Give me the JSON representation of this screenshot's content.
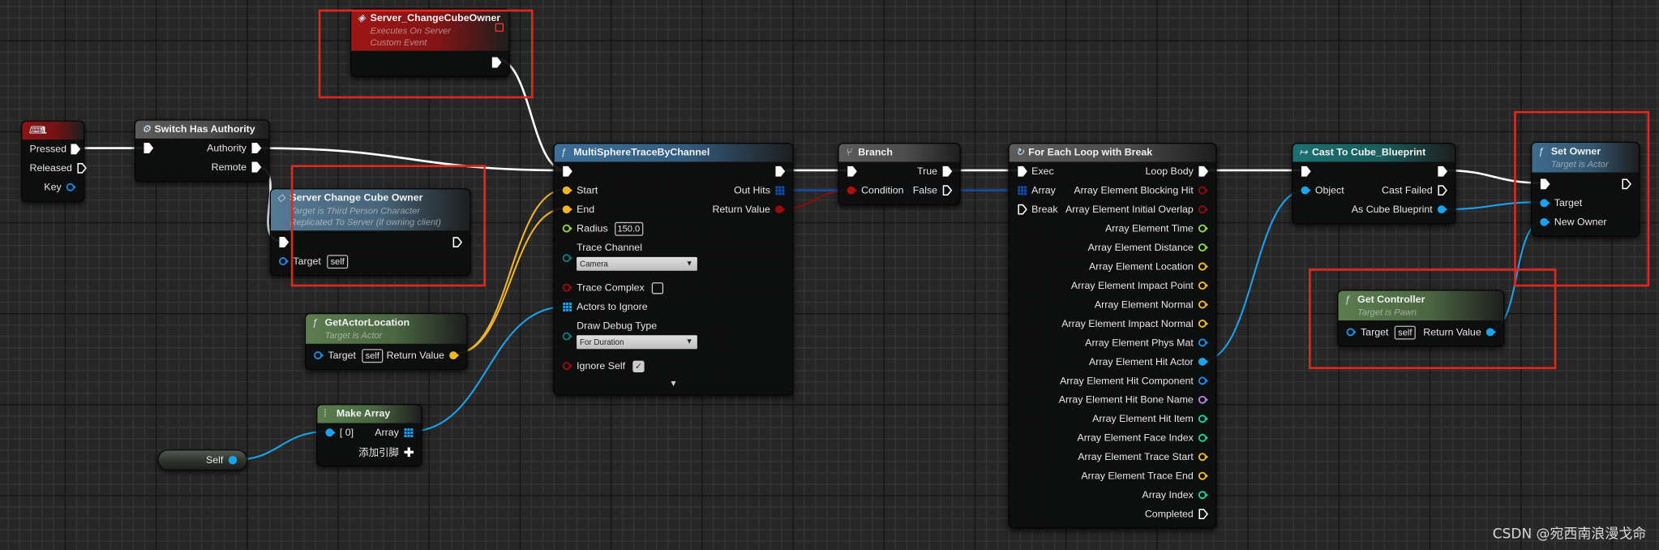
{
  "colors": {
    "exec": "#ffffff",
    "object": "#1aa2ec",
    "vector": "#f0b429",
    "float": "#8ed44a",
    "bool": "#8a0c0c",
    "array_struct": "#1050b8",
    "byte": "#0a8a80",
    "name": "#b57be0",
    "int": "#1ec8a0",
    "annotation": "#e3261f"
  },
  "nodes": [
    {
      "id": "key_event",
      "title": "1",
      "icon": "keyboard-icon",
      "glyph": "⌨",
      "header_color": "#8c1414",
      "rows": [
        {
          "right": {
            "label": "Pressed",
            "kind": "exec",
            "connected": true
          }
        },
        {
          "right": {
            "label": "Released",
            "kind": "exec"
          }
        },
        {
          "right": {
            "label": "Key",
            "kind": "data",
            "color": "#1a7fd8"
          }
        }
      ]
    },
    {
      "id": "switch_authority",
      "title": "Switch Has Authority",
      "icon": "gear-icon",
      "glyph": "⚙",
      "header_color": "#5c5c5c",
      "rows": [
        {
          "left": {
            "kind": "exec",
            "connected": true
          },
          "right": {
            "label": "Authority",
            "kind": "exec",
            "connected": true
          }
        },
        {
          "right": {
            "label": "Remote",
            "kind": "exec",
            "connected": true
          }
        }
      ]
    },
    {
      "id": "server_event",
      "title": "Server_ChangeCubeOwner",
      "icon": "event-icon",
      "glyph": "◈",
      "header_color": "#9e1616",
      "subtitles": [
        "Executes On Server",
        "Custom Event"
      ],
      "delegate": true,
      "rows": [
        {
          "right": {
            "kind": "exec",
            "connected": true
          }
        }
      ]
    },
    {
      "id": "server_call",
      "title": "Server Change Cube Owner",
      "icon": "event-icon",
      "glyph": "◇",
      "header_color": "#557a94",
      "subtitles": [
        "Target is Third Person Character",
        "Replicated To Server (if owning client)"
      ],
      "rows": [
        {
          "left": {
            "kind": "exec",
            "connected": true
          },
          "right": {
            "kind": "exec"
          }
        },
        {
          "left": {
            "label": "Target",
            "kind": "data",
            "color": "#1a8ae0",
            "value": "self"
          }
        }
      ]
    },
    {
      "id": "get_actor_location",
      "title": "GetActorLocation",
      "icon": "function-icon",
      "glyph": "ƒ",
      "header_color": "#5b7d4f",
      "subtitles": [
        "Target is Actor"
      ],
      "rows": [
        {
          "left": {
            "label": "Target",
            "kind": "data",
            "color": "#1a8ae0",
            "value": "self"
          },
          "right": {
            "label": "Return Value",
            "kind": "data",
            "color": "#f0b429",
            "connected": true
          }
        }
      ]
    },
    {
      "id": "make_array",
      "title": "Make Array",
      "icon": "make-array-icon",
      "glyph": "⁞",
      "header_color": "#5b7d4f",
      "rows": [
        {
          "left": {
            "label": "[ 0]",
            "kind": "data",
            "color": "#1aa2ec",
            "connected": true
          },
          "right": {
            "label": "Array",
            "kind": "array",
            "color": "#1aa2ec",
            "connected": true
          }
        },
        {
          "right": {
            "label": "添加引脚",
            "kind": "add"
          }
        }
      ]
    },
    {
      "id": "multisphere",
      "title": "MultiSphereTraceByChannel",
      "icon": "function-icon",
      "glyph": "ƒ",
      "header_color": "#3d6f9a",
      "rows": [
        {
          "left": {
            "kind": "exec",
            "connected": true
          },
          "right": {
            "kind": "exec",
            "connected": true
          }
        },
        {
          "left": {
            "label": "Start",
            "kind": "data",
            "color": "#f0b429",
            "connected": true
          },
          "right": {
            "label": "Out Hits",
            "kind": "array",
            "color": "#1050b8",
            "connected": true
          }
        },
        {
          "left": {
            "label": "End",
            "kind": "data",
            "color": "#f0b429",
            "connected": true
          },
          "right": {
            "label": "Return Value",
            "kind": "data",
            "color": "#9a0c0c",
            "connected": true
          }
        },
        {
          "left": {
            "label": "Radius",
            "kind": "data",
            "color": "#8ed44a",
            "value": "150.0"
          }
        },
        {
          "left": {
            "label": "Trace Channel",
            "kind": "data",
            "color": "#0a7a78",
            "dropdown": "Camera"
          }
        },
        {
          "left": {
            "label": "Trace Complex",
            "kind": "data",
            "color": "#9a0c0c",
            "checkbox": false
          }
        },
        {
          "left": {
            "label": "Actors to Ignore",
            "kind": "array",
            "color": "#1aa2ec",
            "connected": true
          }
        },
        {
          "left": {
            "label": "Draw Debug Type",
            "kind": "data",
            "color": "#0a7a78",
            "dropdown": "For Duration"
          }
        },
        {
          "left": {
            "label": "Ignore Self",
            "kind": "data",
            "color": "#9a0c0c",
            "checkbox": true
          }
        },
        {
          "expand": "▼"
        }
      ]
    },
    {
      "id": "branch",
      "title": "Branch",
      "icon": "branch-icon",
      "glyph": "⑂",
      "header_color": "#5c5c5c",
      "rows": [
        {
          "left": {
            "kind": "exec",
            "connected": true
          },
          "right": {
            "label": "True",
            "kind": "exec",
            "connected": true
          }
        },
        {
          "left": {
            "label": "Condition",
            "kind": "data",
            "color": "#b00d0d",
            "connected": true
          },
          "right": {
            "label": "False",
            "kind": "exec"
          }
        }
      ]
    },
    {
      "id": "foreach",
      "title": "For Each Loop with Break",
      "icon": "loop-icon",
      "glyph": "↻",
      "header_color": "#5c5c5c",
      "rows": [
        {
          "left": {
            "label": "Exec",
            "kind": "exec",
            "connected": true
          },
          "right": {
            "label": "Loop Body",
            "kind": "exec",
            "connected": true
          }
        },
        {
          "left": {
            "label": "Array",
            "kind": "array",
            "color": "#1050b8",
            "connected": true
          },
          "right": {
            "label": "Array Element Blocking Hit",
            "kind": "data",
            "color": "#8a0c0c"
          }
        },
        {
          "left": {
            "label": "Break",
            "kind": "exec"
          },
          "right": {
            "label": "Array Element Initial Overlap",
            "kind": "data",
            "color": "#8a0c0c"
          }
        },
        {
          "right": {
            "label": "Array Element Time",
            "kind": "data",
            "color": "#8ed44a"
          }
        },
        {
          "right": {
            "label": "Array Element Distance",
            "kind": "data",
            "color": "#8ed44a"
          }
        },
        {
          "right": {
            "label": "Array Element Location",
            "kind": "data",
            "color": "#f0b429"
          }
        },
        {
          "right": {
            "label": "Array Element Impact Point",
            "kind": "data",
            "color": "#f0b429"
          }
        },
        {
          "right": {
            "label": "Array Element Normal",
            "kind": "data",
            "color": "#f0b429"
          }
        },
        {
          "right": {
            "label": "Array Element Impact Normal",
            "kind": "data",
            "color": "#f0b429"
          }
        },
        {
          "right": {
            "label": "Array Element Phys Mat",
            "kind": "data",
            "color": "#1a8ae0"
          }
        },
        {
          "right": {
            "label": "Array Element Hit Actor",
            "kind": "data",
            "color": "#1aa2ec",
            "connected": true
          }
        },
        {
          "right": {
            "label": "Array Element Hit Component",
            "kind": "data",
            "color": "#1a8ae0"
          }
        },
        {
          "right": {
            "label": "Array Element Hit Bone Name",
            "kind": "data",
            "color": "#b57be0"
          }
        },
        {
          "right": {
            "label": "Array Element Hit Item",
            "kind": "data",
            "color": "#1ec8a0"
          }
        },
        {
          "right": {
            "label": "Array Element Face Index",
            "kind": "data",
            "color": "#1ec8a0"
          }
        },
        {
          "right": {
            "label": "Array Element Trace Start",
            "kind": "data",
            "color": "#f0b429"
          }
        },
        {
          "right": {
            "label": "Array Element Trace End",
            "kind": "data",
            "color": "#f0b429"
          }
        },
        {
          "right": {
            "label": "Array Index",
            "kind": "data",
            "color": "#1ec8a0"
          }
        },
        {
          "right": {
            "label": "Completed",
            "kind": "exec"
          }
        }
      ]
    },
    {
      "id": "cast",
      "title": "Cast To Cube_Blueprint",
      "icon": "cast-icon",
      "glyph": "↦",
      "header_color": "#1d7070",
      "rows": [
        {
          "left": {
            "kind": "exec",
            "connected": true
          },
          "right": {
            "kind": "exec",
            "connected": true
          }
        },
        {
          "left": {
            "label": "Object",
            "kind": "data",
            "color": "#1aa2ec",
            "connected": true
          },
          "right": {
            "label": "Cast Failed",
            "kind": "exec"
          }
        },
        {
          "right": {
            "label": "As Cube Blueprint",
            "kind": "data",
            "color": "#1aa2ec",
            "connected": true
          }
        }
      ]
    },
    {
      "id": "set_owner",
      "title": "Set Owner",
      "icon": "function-icon",
      "glyph": "ƒ",
      "header_color": "#3e6a8a",
      "subtitles": [
        "Target is Actor"
      ],
      "rows": [
        {
          "left": {
            "kind": "exec",
            "connected": true
          },
          "right": {
            "kind": "exec"
          }
        },
        {
          "left": {
            "label": "Target",
            "kind": "data",
            "color": "#1aa2ec",
            "connected": true
          }
        },
        {
          "left": {
            "label": "New Owner",
            "kind": "data",
            "color": "#1aa2ec",
            "connected": true
          }
        }
      ]
    },
    {
      "id": "get_controller",
      "title": "Get Controller",
      "icon": "function-icon",
      "glyph": "ƒ",
      "header_color": "#5b7d4f",
      "subtitles": [
        "Target is Pawn"
      ],
      "rows": [
        {
          "left": {
            "label": "Target",
            "kind": "data",
            "color": "#1a8ae0",
            "value": "self"
          },
          "right": {
            "label": "Return Value",
            "kind": "data",
            "color": "#1aa2ec",
            "connected": true
          }
        }
      ]
    }
  ],
  "self_node": {
    "label": "Self",
    "color": "#1aa2ec"
  },
  "watermark": "CSDN @宛西南浪漫戈命"
}
